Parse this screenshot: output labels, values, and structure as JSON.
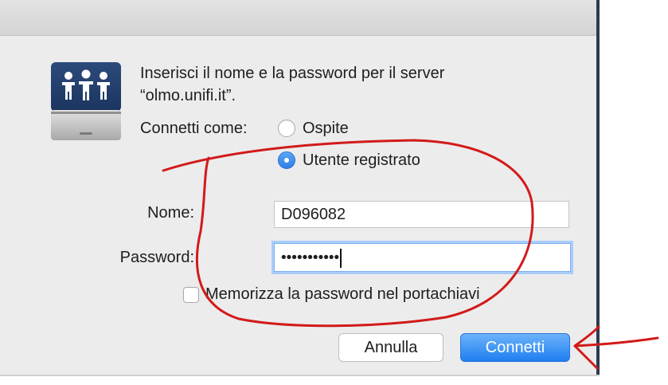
{
  "dialog": {
    "message_line1": "Inserisci il nome e la password per il server",
    "message_line2": "“olmo.unifi.it”.",
    "connect_as_label": "Connetti come:",
    "radio_guest": "Ospite",
    "radio_registered_user": "Utente registrato",
    "selected_option": "Utente registrato",
    "name_label": "Nome:",
    "name_value": "D096082",
    "password_label": "Password:",
    "password_masked": "•••••••••••",
    "remember_label": "Memorizza la password nel portachiavi",
    "remember_checked": false,
    "cancel_label": "Annulla",
    "connect_label": "Connetti"
  },
  "icons": {
    "server": "shared-server-icon"
  },
  "colors": {
    "accent": "#2f7ee6",
    "annotation": "#d21a1a",
    "window_bg": "#ececec"
  }
}
